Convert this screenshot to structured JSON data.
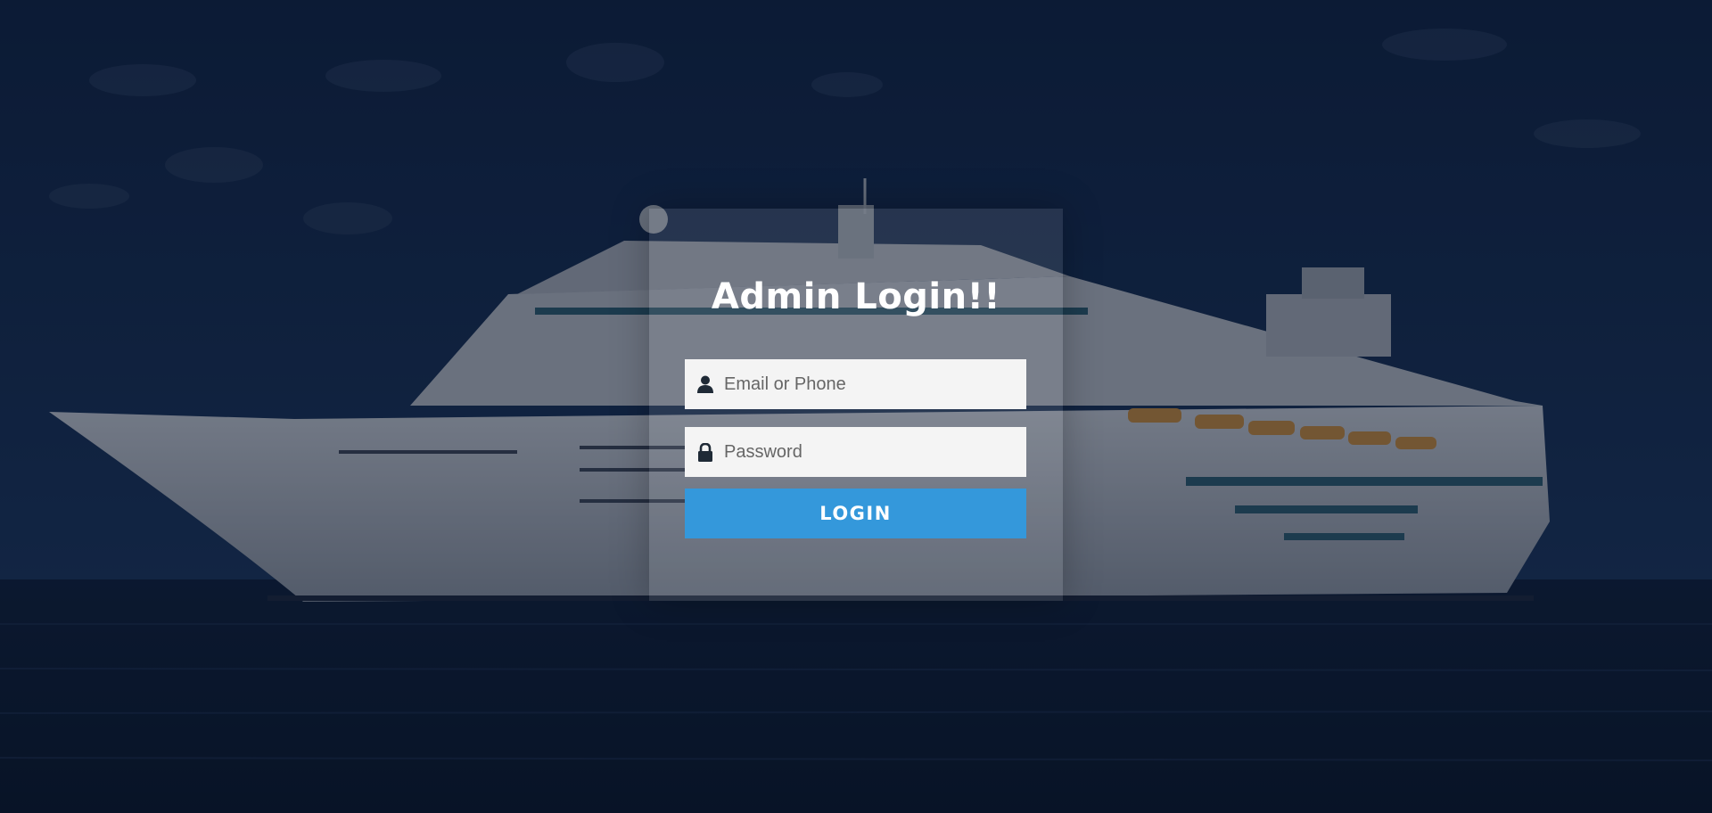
{
  "login": {
    "title": "Admin Login!!",
    "email_placeholder": "Email or Phone",
    "email_value": "",
    "email_icon": "user-icon",
    "password_placeholder": "Password",
    "password_value": "",
    "password_icon": "lock-icon",
    "button_label": "LOGIN"
  },
  "colors": {
    "button": "#3498db",
    "input_bg": "#f4f4f4",
    "title": "#ffffff",
    "background": "#0e1c33"
  }
}
